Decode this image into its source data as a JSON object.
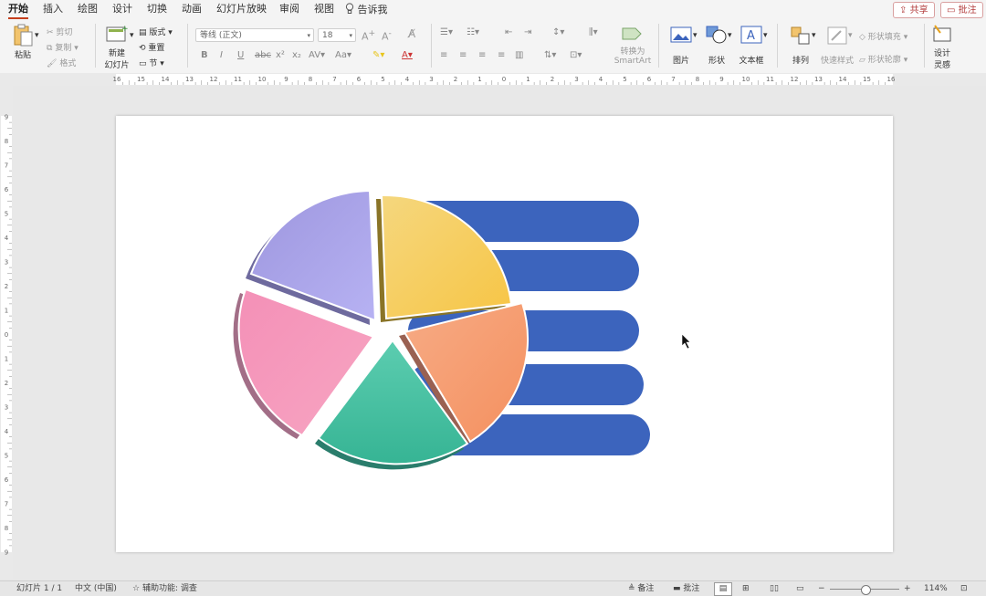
{
  "tabs": [
    "开始",
    "插入",
    "绘图",
    "设计",
    "切换",
    "动画",
    "幻灯片放映",
    "审阅",
    "视图"
  ],
  "tell_me": "告诉我",
  "share_label": "共享",
  "comment_label": "批注",
  "ribbon": {
    "paste": "粘贴",
    "cut": "剪切",
    "copy": "复制",
    "format_painter": "格式",
    "new_slide_1": "新建",
    "new_slide_2": "幻灯片",
    "layout": "版式",
    "reset": "重置",
    "section": "节",
    "font_name": "等线 (正文)",
    "font_size": "18",
    "convert_1": "转换为",
    "convert_2": "SmartArt",
    "picture": "图片",
    "shape": "形状",
    "textbox": "文本框",
    "arrange": "排列",
    "quick_styles": "快速样式",
    "shape_fill": "形状填充",
    "shape_outline": "形状轮廓",
    "designer_1": "设计",
    "designer_2": "灵感"
  },
  "status": {
    "slide_count": "幻灯片 1 / 1",
    "language": "中文 (中国)",
    "accessibility": "辅助功能: 调查",
    "notes": "备注",
    "comments": "批注",
    "zoom": "114%"
  },
  "colors": {
    "accent": "#c43e1c",
    "bar": "#3c64bd",
    "slice_yellow": "#f7cf5a",
    "slice_orange": "#f59a6e",
    "slice_green": "#3fbf9f",
    "slice_pink": "#f48bb0",
    "slice_purple": "#a9a2e4"
  }
}
